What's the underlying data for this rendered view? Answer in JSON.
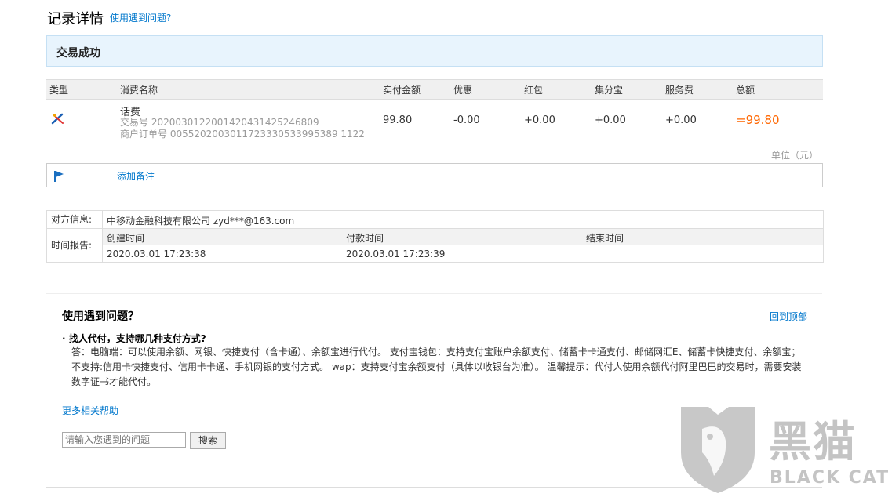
{
  "header": {
    "title": "记录详情",
    "help_link": "使用遇到问题?"
  },
  "status": {
    "text": "交易成功"
  },
  "table": {
    "columns": [
      "类型",
      "消费名称",
      "实付金额",
      "优惠",
      "红包",
      "集分宝",
      "服务费",
      "总额"
    ],
    "row": {
      "type_icon": "phone-recharge-icon",
      "name": "话费",
      "trade_no": "交易号 2020030122001420431425246809",
      "merchant_no": "商户订单号 0055202003011723330533995389 1122",
      "paid": "99.80",
      "discount": "-0.00",
      "redpack": "+0.00",
      "points": "+0.00",
      "fee": "+0.00",
      "total": "=99.80"
    },
    "unit": "单位（元）"
  },
  "note": {
    "label": "添加备注",
    "icon": "flag-icon"
  },
  "info": {
    "counterparty_label": "对方信息:",
    "counterparty_value": "中移动金融科技有限公司 zyd***@163.com",
    "time_label": "时间报告:",
    "time_headers": [
      "创建时间",
      "付款时间",
      "结束时间"
    ],
    "time_values": [
      "2020.03.01 17:23:38",
      "2020.03.01 17:23:39",
      ""
    ]
  },
  "help": {
    "title": "使用遇到问题？",
    "back_to_top": "回到顶部",
    "question": "找人代付，支持哪几种支付方式?",
    "answer_line1": "答：电脑端：可以使用余额、网银、快捷支付（含卡通）、余额宝进行代付。 支付宝钱包：支持支付宝账户余额支付、储蓄卡卡通支付、邮储网汇E、储蓄卡快捷支付、余额宝；",
    "answer_line2": "不支持:信用卡快捷支付、信用卡卡通、手机网银的支付方式。 wap：支持支付宝余额支付（具体以收银台为准）。 温馨提示：代付人使用余额代付阿里巴巴的交易时，需要安装",
    "answer_line3": "数字证书才能代付。",
    "more_help": "更多相关帮助",
    "search_placeholder": "请输入您遇到的问题",
    "search_button": "搜索"
  },
  "watermark": {
    "cn": "黑猫",
    "en": "BLACK CAT"
  }
}
